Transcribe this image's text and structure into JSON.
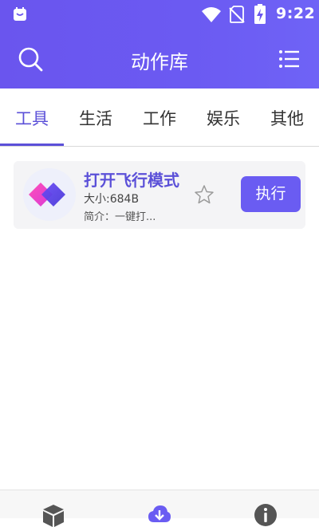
{
  "status_bar": {
    "time": "9:22",
    "icons": [
      "app-notification-icon",
      "wifi-icon",
      "no-sim-icon",
      "battery-charging-icon"
    ]
  },
  "toolbar": {
    "title": "动作库",
    "left_icon": "search-icon",
    "right_icon": "list-menu-icon"
  },
  "tabs": [
    {
      "label": "工具",
      "active": true
    },
    {
      "label": "生活",
      "active": false
    },
    {
      "label": "工作",
      "active": false
    },
    {
      "label": "娱乐",
      "active": false
    },
    {
      "label": "其他",
      "active": false
    }
  ],
  "actions": [
    {
      "title": "打开飞行模式",
      "size": "大小:684B",
      "description": "简介：一键打...",
      "icon": "airplane-mode-action-icon",
      "favorite_icon": "star-outline-icon",
      "run_label": "执行"
    }
  ],
  "bottom_nav": [
    {
      "icon": "box-icon"
    },
    {
      "icon": "cloud-download-icon"
    },
    {
      "icon": "info-icon"
    }
  ],
  "colors": {
    "accent": "#5b50d8",
    "header_bg": "#6a55ee",
    "button_bg": "#6a5cf2",
    "card_bg": "#f4f4f6"
  }
}
